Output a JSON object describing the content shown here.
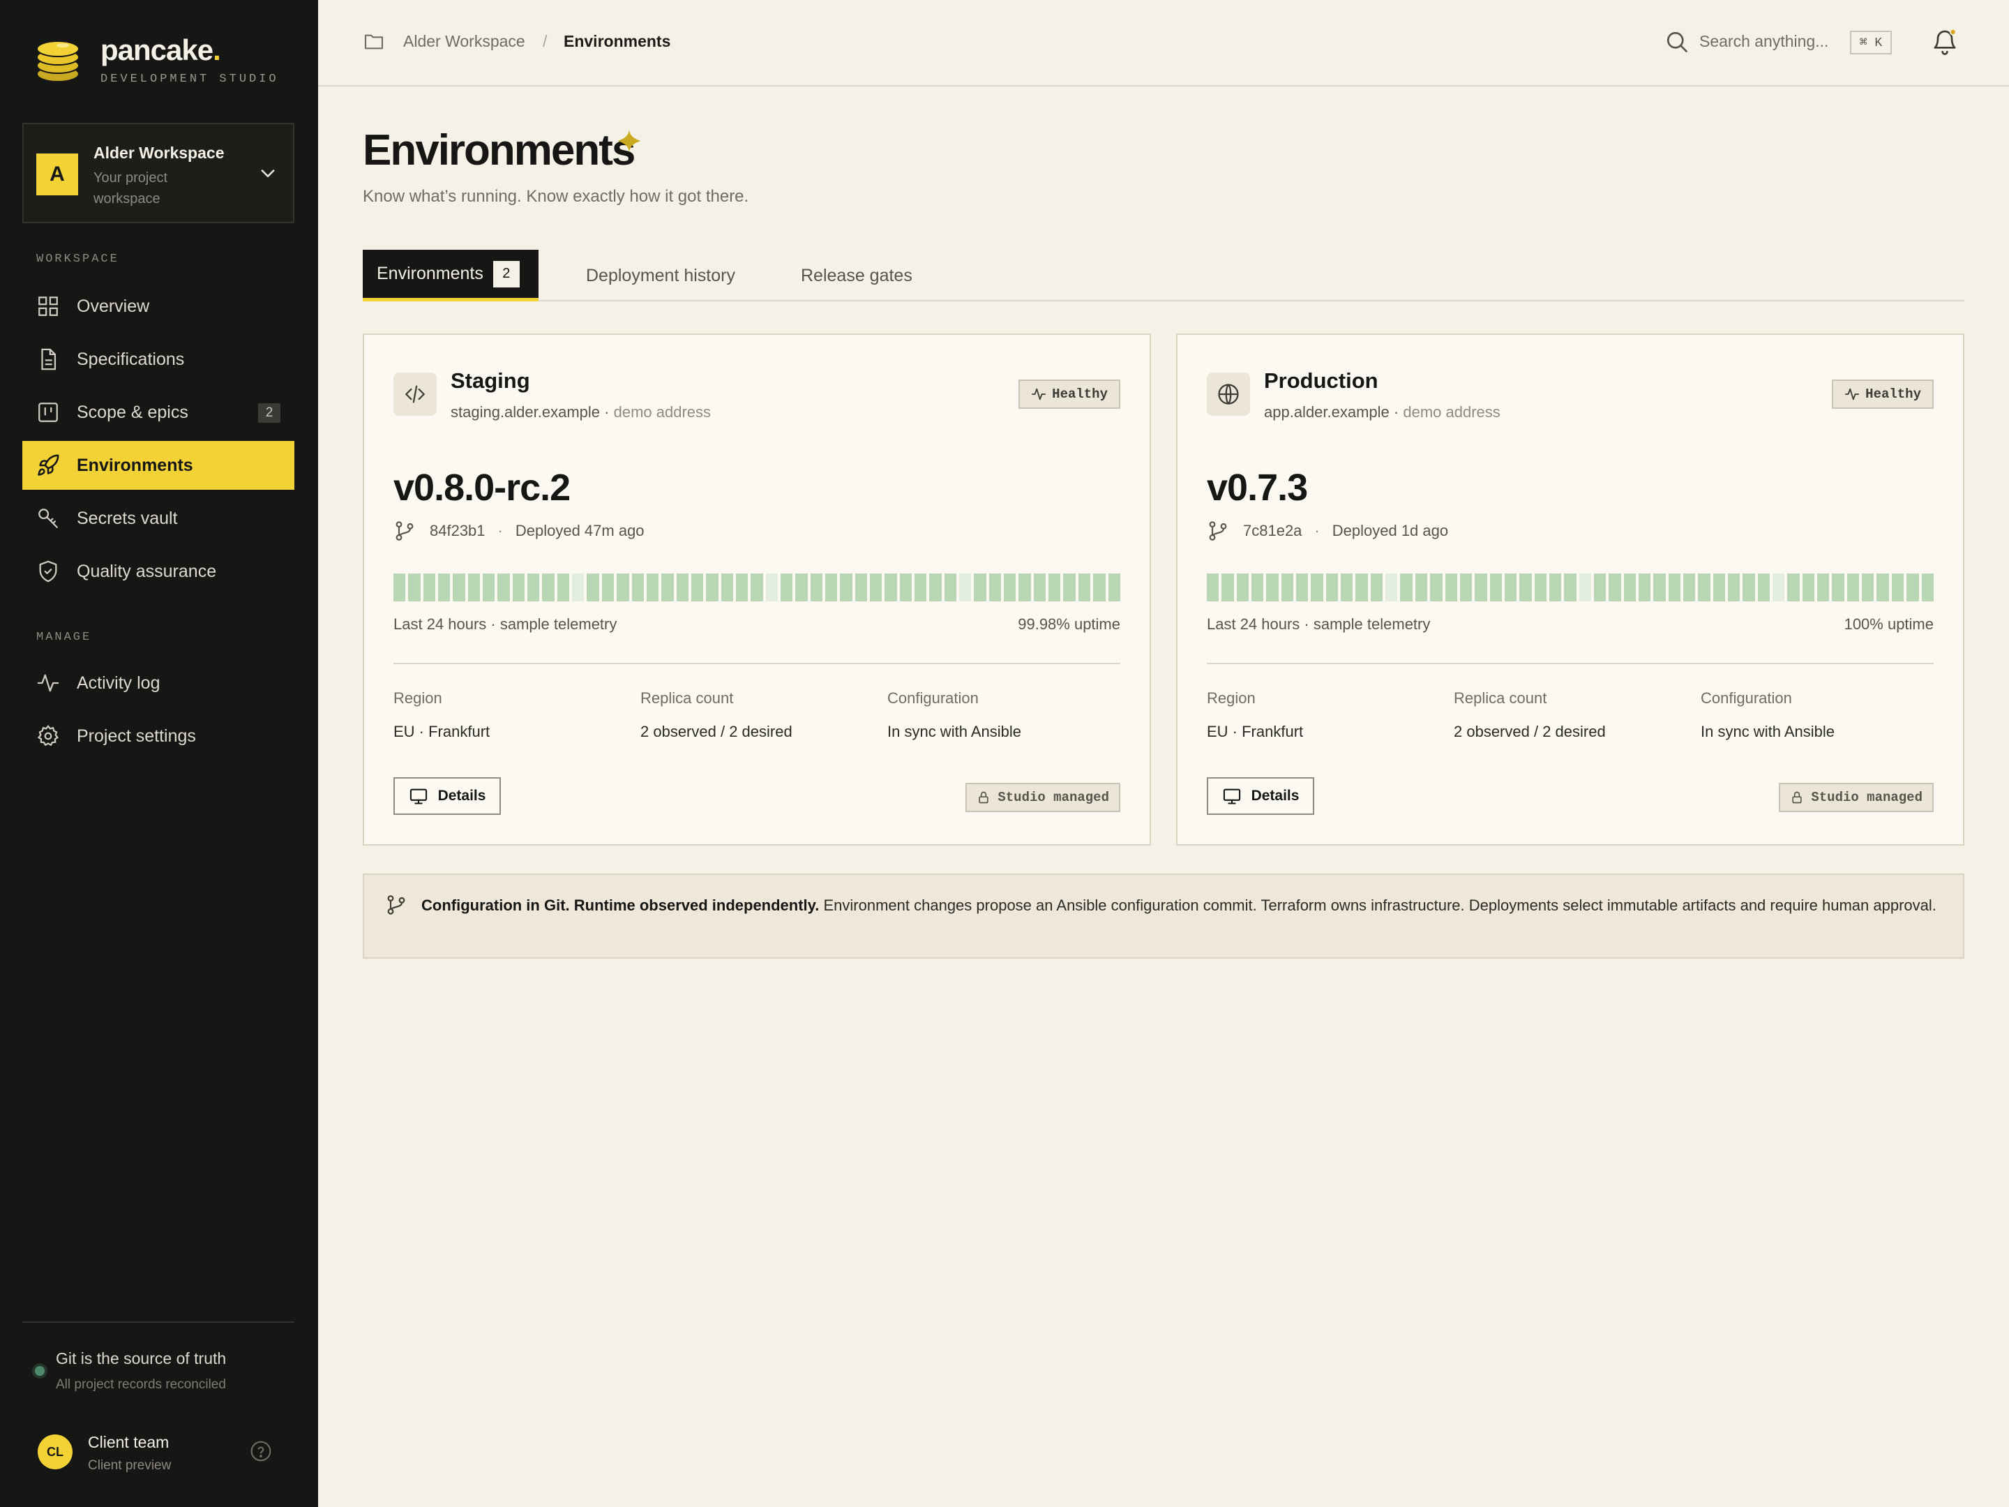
{
  "brand": {
    "name": "pancake",
    "dot": ".",
    "subtitle": "DEVELOPMENT STUDIO"
  },
  "workspace": {
    "initial": "A",
    "name": "Alder Workspace",
    "subtitle": "Your project workspace"
  },
  "sidebar": {
    "sections": {
      "workspace": "WORKSPACE",
      "manage": "MANAGE"
    },
    "items": [
      {
        "label": "Overview",
        "icon": "grid-icon"
      },
      {
        "label": "Specifications",
        "icon": "document-icon"
      },
      {
        "label": "Scope & epics",
        "icon": "kanban-icon",
        "badge": "2"
      },
      {
        "label": "Environments",
        "icon": "rocket-icon",
        "active": true
      },
      {
        "label": "Secrets vault",
        "icon": "key-icon"
      },
      {
        "label": "Quality assurance",
        "icon": "shield-icon"
      },
      {
        "label": "Activity log",
        "icon": "activity-icon"
      },
      {
        "label": "Project settings",
        "icon": "gear-icon"
      }
    ],
    "status": {
      "title": "Git is the source of truth",
      "subtitle": "All project records reconciled"
    },
    "user": {
      "initials": "CL",
      "name": "Client team",
      "role": "Client preview"
    }
  },
  "topbar": {
    "breadcrumb": [
      "Alder Workspace",
      "Environments"
    ],
    "breadcrumb_separator": "/",
    "search_placeholder": "Search anything...",
    "search_shortcut": "⌘ K"
  },
  "page": {
    "title": "Environments",
    "subtitle": "Know what’s running. Know exactly how it got there."
  },
  "tabs": [
    {
      "label": "Environments",
      "badge": "2",
      "active": true
    },
    {
      "label": "Deployment history"
    },
    {
      "label": "Release gates"
    }
  ],
  "environments": [
    {
      "name": "Staging",
      "icon": "code-icon",
      "host": "staging.alder.example",
      "host_note": "demo address",
      "status": "Healthy",
      "version": "v0.8.0-rc.2",
      "commit": "84f23b1",
      "deployed": "Deployed 47m ago",
      "telemetry_label": "Last 24 hours · sample telemetry",
      "uptime": "99.98% uptime",
      "uptime_bars": [
        1,
        1,
        1,
        1,
        1,
        1,
        1,
        1,
        1,
        1,
        1,
        1,
        0,
        1,
        1,
        1,
        1,
        1,
        1,
        1,
        1,
        1,
        1,
        1,
        1,
        0,
        1,
        1,
        1,
        1,
        1,
        1,
        1,
        1,
        1,
        1,
        1,
        1,
        0,
        1,
        1,
        1,
        1,
        1,
        1,
        1,
        1,
        1,
        1
      ],
      "meta": [
        {
          "label": "Region",
          "value": "EU · Frankfurt"
        },
        {
          "label": "Replica count",
          "value": "2 observed / 2 desired"
        },
        {
          "label": "Configuration",
          "value": "In sync with Ansible"
        }
      ],
      "details_label": "Details",
      "managed_label": "Studio managed"
    },
    {
      "name": "Production",
      "icon": "globe-icon",
      "host": "app.alder.example",
      "host_note": "demo address",
      "status": "Healthy",
      "version": "v0.7.3",
      "commit": "7c81e2a",
      "deployed": "Deployed 1d ago",
      "telemetry_label": "Last 24 hours · sample telemetry",
      "uptime": "100% uptime",
      "uptime_bars": [
        1,
        1,
        1,
        1,
        1,
        1,
        1,
        1,
        1,
        1,
        1,
        1,
        0,
        1,
        1,
        1,
        1,
        1,
        1,
        1,
        1,
        1,
        1,
        1,
        1,
        0,
        1,
        1,
        1,
        1,
        1,
        1,
        1,
        1,
        1,
        1,
        1,
        1,
        0,
        1,
        1,
        1,
        1,
        1,
        1,
        1,
        1,
        1,
        1
      ],
      "meta": [
        {
          "label": "Region",
          "value": "EU · Frankfurt"
        },
        {
          "label": "Replica count",
          "value": "2 observed / 2 desired"
        },
        {
          "label": "Configuration",
          "value": "In sync with Ansible"
        }
      ],
      "details_label": "Details",
      "managed_label": "Studio managed"
    }
  ],
  "info": {
    "bold": "Configuration in Git. Runtime observed independently.",
    "text": " Environment changes propose an Ansible configuration commit. Terraform owns infrastructure. Deployments select immutable artifacts and require human approval."
  },
  "colors": {
    "accent": "#f2d235",
    "sidebar_bg": "#161614",
    "page_bg": "#f5f1e6",
    "healthy_bar": "#b9d6b4",
    "status_ok": "#4d8a6a"
  }
}
